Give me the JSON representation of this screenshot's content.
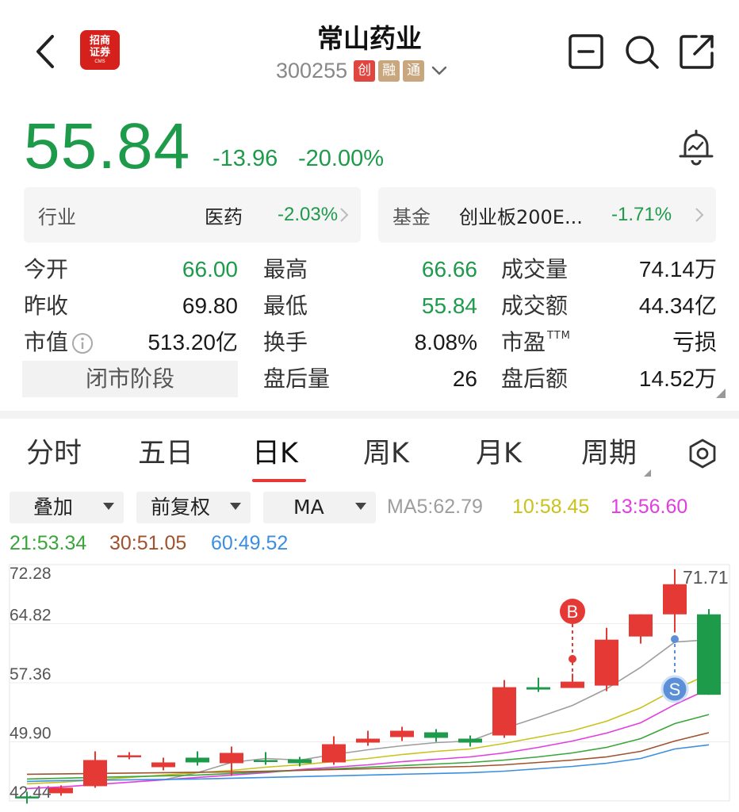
{
  "header": {
    "title": "常山药业",
    "code": "300255",
    "tags": [
      "创",
      "融",
      "通"
    ],
    "logo_line1": "招商",
    "logo_line2": "证券",
    "logo_small": "CMS"
  },
  "quote": {
    "price": "55.84",
    "change": "-13.96",
    "change_pct": "-20.00%",
    "up_color": "#e53935",
    "down_color": "#1e9a4b"
  },
  "industry": {
    "label": "行业",
    "name": "医药",
    "pct": "-2.03%"
  },
  "fund": {
    "label": "基金",
    "name": "创业板200E...",
    "pct": "-1.71%"
  },
  "stats": {
    "open_label": "今开",
    "open": "66.00",
    "prev_close_label": "昨收",
    "prev_close": "69.80",
    "mcap_label": "市值",
    "mcap": "513.20亿",
    "high_label": "最高",
    "high": "66.66",
    "low_label": "最低",
    "low": "55.84",
    "turnover_label": "换手",
    "turnover": "8.08%",
    "after_vol_label": "盘后量",
    "after_vol": "26",
    "volume_label": "成交量",
    "volume": "74.14万",
    "amount_label": "成交额",
    "amount": "44.34亿",
    "pe_label": "市盈",
    "pe_sup": "TTM",
    "pe": "亏损",
    "after_amt_label": "盘后额",
    "after_amt": "14.52万",
    "stage": "闭市阶段"
  },
  "tabs": [
    "分时",
    "五日",
    "日K",
    "周K",
    "月K",
    "周期"
  ],
  "active_tab": "日K",
  "dropdowns": [
    "叠加",
    "前复权",
    "MA"
  ],
  "ma": {
    "ma5": "MA5:62.79",
    "ma10": "10:58.45",
    "ma13": "13:56.60",
    "ma21": "21:53.34",
    "ma30": "30:51.05",
    "ma60": "60:49.52",
    "colors": {
      "ma5": "#9e9e9e",
      "ma10": "#c9c21a",
      "ma13": "#e23de0",
      "ma21": "#3aa53a",
      "ma30": "#a0522d",
      "ma60": "#3a8fe0"
    }
  },
  "chart_data": {
    "type": "candlestick",
    "y_ticks": [
      "72.28",
      "64.82",
      "57.36",
      "49.90",
      "42.44"
    ],
    "ylim": [
      42.44,
      72.28
    ],
    "high_label": "71.71",
    "markers": {
      "buy": "B",
      "sell": "S"
    },
    "candles": [
      {
        "o": 43.0,
        "c": 42.8,
        "h": 43.6,
        "l": 42.1
      },
      {
        "o": 43.4,
        "c": 44.1,
        "h": 44.4,
        "l": 43.1
      },
      {
        "o": 44.3,
        "c": 47.6,
        "h": 48.7,
        "l": 44.1
      },
      {
        "o": 48.0,
        "c": 48.2,
        "h": 48.6,
        "l": 47.7
      },
      {
        "o": 46.7,
        "c": 47.3,
        "h": 47.9,
        "l": 46.3
      },
      {
        "o": 47.9,
        "c": 47.3,
        "h": 48.7,
        "l": 46.9
      },
      {
        "o": 47.2,
        "c": 48.5,
        "h": 49.3,
        "l": 45.6
      },
      {
        "o": 47.6,
        "c": 47.4,
        "h": 48.6,
        "l": 47.0
      },
      {
        "o": 47.7,
        "c": 47.2,
        "h": 48.0,
        "l": 46.8
      },
      {
        "o": 47.3,
        "c": 49.6,
        "h": 50.6,
        "l": 47.0
      },
      {
        "o": 49.8,
        "c": 50.3,
        "h": 51.3,
        "l": 49.4
      },
      {
        "o": 50.5,
        "c": 51.3,
        "h": 51.8,
        "l": 50.0
      },
      {
        "o": 51.1,
        "c": 50.4,
        "h": 51.5,
        "l": 49.9
      },
      {
        "o": 50.3,
        "c": 49.8,
        "h": 50.7,
        "l": 49.3
      },
      {
        "o": 50.7,
        "c": 56.8,
        "h": 57.7,
        "l": 50.4
      },
      {
        "o": 56.8,
        "c": 56.5,
        "h": 58.0,
        "l": 56.2
      },
      {
        "o": 56.7,
        "c": 57.5,
        "h": 58.5,
        "l": 56.7
      },
      {
        "o": 57.0,
        "c": 62.8,
        "h": 64.3,
        "l": 56.3
      },
      {
        "o": 63.2,
        "c": 66.0,
        "h": 66.0,
        "l": 62.3
      },
      {
        "o": 66.0,
        "c": 69.8,
        "h": 71.7,
        "l": 63.7
      },
      {
        "o": 66.0,
        "c": 55.84,
        "h": 66.66,
        "l": 55.84
      }
    ],
    "ma_series": {
      "ma5": [
        null,
        null,
        null,
        null,
        45.1,
        46.0,
        47.3,
        47.8,
        47.6,
        48.3,
        48.9,
        49.4,
        49.8,
        50.0,
        51.6,
        53.0,
        54.5,
        56.6,
        59.3,
        62.5,
        62.79
      ],
      "ma10": [
        44.6,
        44.8,
        45.1,
        45.4,
        45.7,
        46.0,
        46.3,
        46.7,
        47.0,
        47.4,
        47.8,
        48.3,
        48.7,
        49.0,
        49.7,
        50.5,
        51.3,
        52.5,
        54.2,
        56.5,
        58.45
      ],
      "ma13": [
        44.0,
        44.2,
        44.5,
        44.8,
        45.1,
        45.4,
        45.7,
        46.0,
        46.4,
        46.7,
        47.0,
        47.4,
        47.7,
        48.0,
        48.5,
        49.2,
        50.0,
        51.0,
        52.3,
        54.6,
        56.6
      ],
      "ma21": [
        45.2,
        45.3,
        45.4,
        45.5,
        45.6,
        45.7,
        45.9,
        46.1,
        46.3,
        46.5,
        46.7,
        46.9,
        47.1,
        47.3,
        47.6,
        48.0,
        48.5,
        49.2,
        50.3,
        52.2,
        53.34
      ],
      "ma30": [
        45.8,
        45.85,
        45.9,
        45.95,
        46.0,
        46.05,
        46.1,
        46.2,
        46.3,
        46.4,
        46.5,
        46.6,
        46.7,
        46.8,
        47.0,
        47.3,
        47.6,
        48.0,
        48.7,
        50.0,
        51.05
      ],
      "ma60": [
        44.9,
        45.0,
        45.05,
        45.1,
        45.15,
        45.2,
        45.3,
        45.4,
        45.5,
        45.6,
        45.7,
        45.8,
        45.9,
        46.0,
        46.2,
        46.5,
        46.8,
        47.2,
        47.8,
        49.0,
        49.52
      ]
    }
  }
}
